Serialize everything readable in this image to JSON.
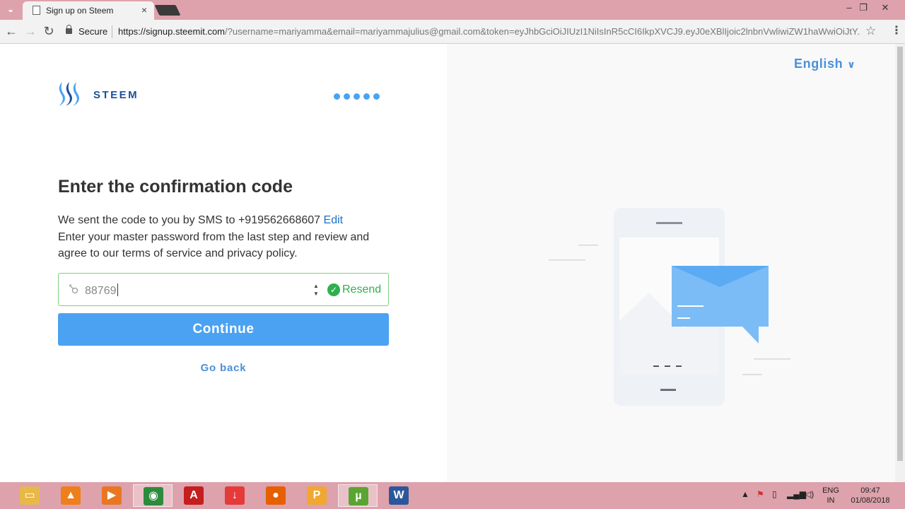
{
  "browser": {
    "tab_title": "Sign up on Steem",
    "tab_close": "×",
    "secure_label": "Secure",
    "url_host": "https://signup.steemit.com",
    "url_rest": "/?username=mariyamma&email=mariyammajulius@gmail.com&token=eyJhbGciOiJIUzI1NiIsInR5cCI6IkpXVCJ9.eyJ0eXBlIjoic2lnbnVwliwiZW1haWwiOiJtY...",
    "minimize": "–",
    "restore": "❐",
    "close": "✕"
  },
  "brand": {
    "name": "STEEM"
  },
  "progress": {
    "steps": 5,
    "color": "#4ba2f2"
  },
  "language": {
    "label": "English"
  },
  "form": {
    "heading": "Enter the confirmation code",
    "sms_text": "We sent the code to you by SMS to +919562668607",
    "edit_label": "Edit",
    "instructions": "Enter your master password from the last step and review and agree to our terms of service and privacy policy.",
    "code_value": "88769",
    "resend_label": "Resend",
    "continue_label": "Continue",
    "go_back_label": "Go back"
  },
  "colors": {
    "accent": "#4ba2f2",
    "link": "#4a90d9",
    "success": "#2eb04d",
    "brand_dark": "#1a5099"
  },
  "taskbar": {
    "apps": [
      {
        "name": "file-explorer-icon",
        "glyph": "▭",
        "color": "#e8b84a"
      },
      {
        "name": "vlc-icon",
        "glyph": "▲",
        "color": "#ef7f1a"
      },
      {
        "name": "media-player-icon",
        "glyph": "▶",
        "color": "#e87722"
      },
      {
        "name": "chrome-icon",
        "glyph": "◉",
        "color": "#2e8b3e"
      },
      {
        "name": "acrobat-icon",
        "glyph": "A",
        "color": "#c41e1e"
      },
      {
        "name": "download-manager-icon",
        "glyph": "↓",
        "color": "#e53a3a"
      },
      {
        "name": "firefox-icon",
        "glyph": "●",
        "color": "#e66000"
      },
      {
        "name": "powerpoint-viewer-icon",
        "glyph": "P",
        "color": "#f0a830"
      },
      {
        "name": "utorrent-icon",
        "glyph": "µ",
        "color": "#5aa532"
      },
      {
        "name": "word-icon",
        "glyph": "W",
        "color": "#2b579a"
      }
    ],
    "lang_line1": "ENG",
    "lang_line2": "IN",
    "time": "09:47",
    "date": "01/08/2018"
  }
}
